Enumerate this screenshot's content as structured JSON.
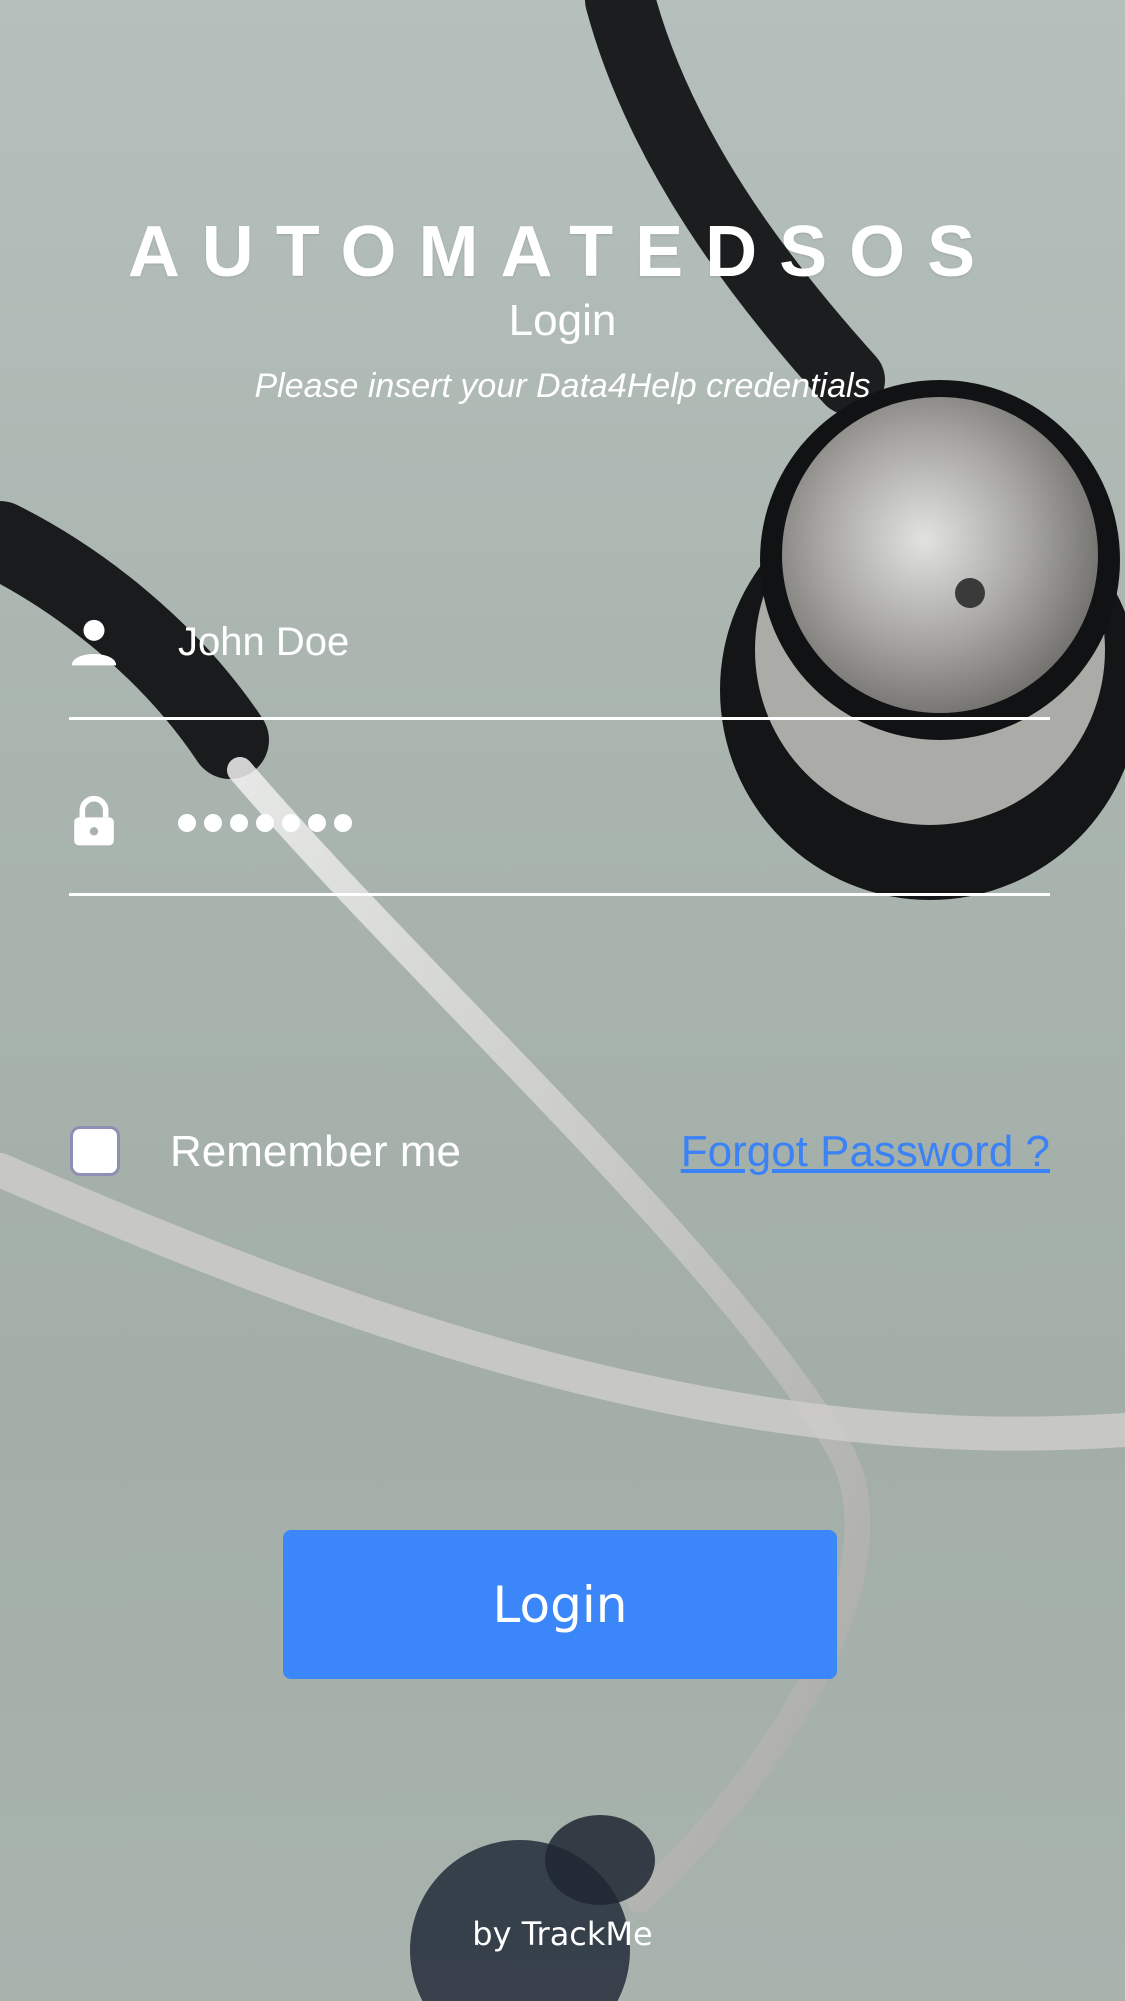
{
  "app": {
    "title": "AUTOMATEDSOS",
    "subtitle": "Login",
    "hint": "Please insert your Data4Help credentials"
  },
  "form": {
    "username": {
      "icon": "person-icon",
      "value": "John Doe"
    },
    "password": {
      "icon": "lock-icon",
      "masked_length": 7
    },
    "remember_me": {
      "label": "Remember me",
      "checked": false
    },
    "forgot_password_label": "Forgot Password ?",
    "login_button_label": "Login"
  },
  "footer": {
    "text": "by TrackMe"
  },
  "colors": {
    "accent": "#3b86f8",
    "link": "#3b82f6",
    "text": "#ffffff"
  }
}
